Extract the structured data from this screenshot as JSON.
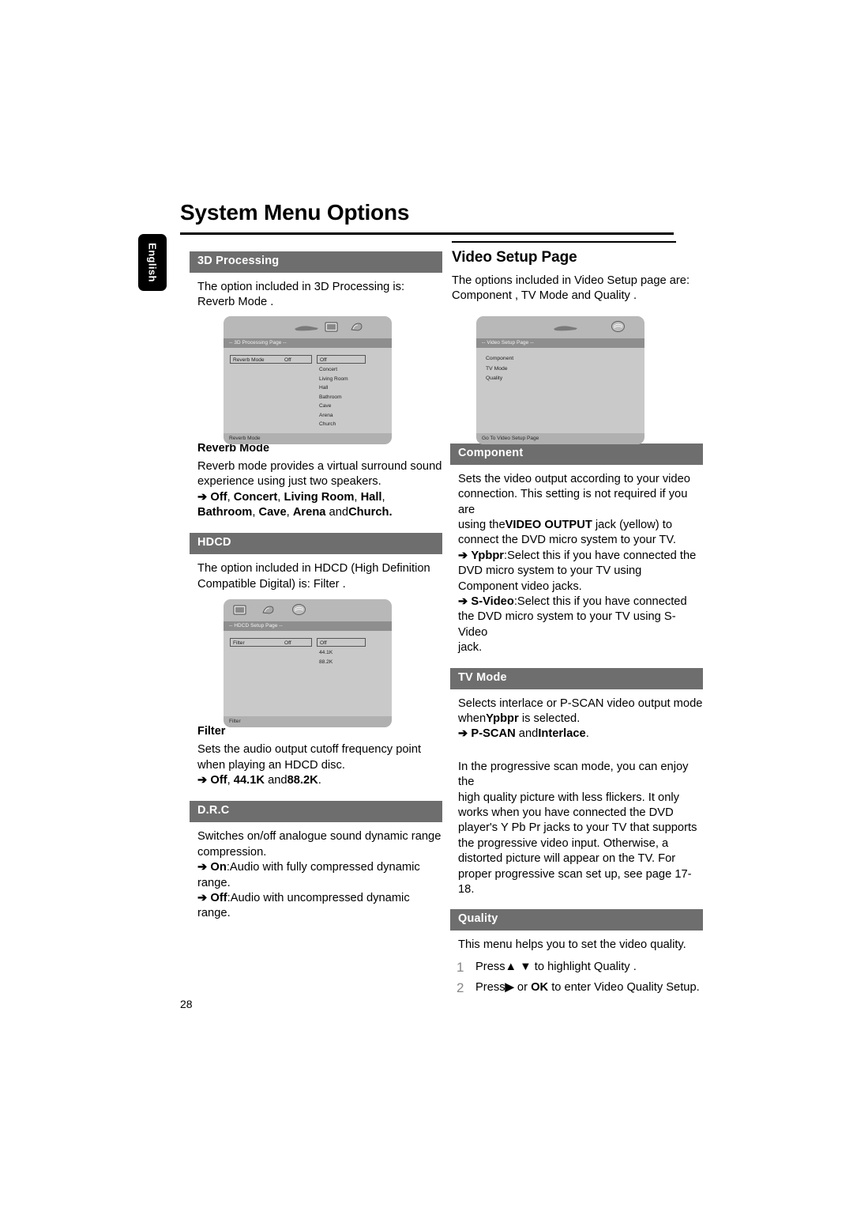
{
  "page": {
    "title": "System Menu Options",
    "language_tab": "English",
    "page_number": "28"
  },
  "left_column": {
    "processing": {
      "bar_label": "3D Processing",
      "intro_line1": "The option included in 3D Processing is:",
      "intro_line2": "Reverb Mode ."
    },
    "osd_3d": {
      "title": "-- 3D Processing Page --",
      "row_label": "Reverb Mode",
      "row_value": "Off",
      "selected_option": "Off",
      "options": [
        "Concert",
        "Living Room",
        "Hall",
        "Bathroom",
        "Cave",
        "Arena",
        "Church"
      ],
      "status": "Reverb Mode",
      "icons": [
        "video-icon",
        "audio-icon"
      ]
    },
    "reverb": {
      "head": "Reverb Mode",
      "body_line1": "Reverb mode provides a virtual surround sound",
      "body_line2": "experience using just two speakers.",
      "bullet_prefix": "➔",
      "bullet_line1_bold1": "Off",
      "bullet_line1_sep1": ", ",
      "bullet_line1_bold2": "Concert",
      "bullet_line1_sep2": ", ",
      "bullet_line1_bold3": "Living Room",
      "bullet_line1_sep3": ", ",
      "bullet_line1_bold4": "Hall",
      "bullet_line1_end": ",",
      "bullet_line2_bold1": "Bathroom",
      "bullet_line2_sep1": ", ",
      "bullet_line2_bold2": "Cave",
      "bullet_line2_sep2": ", ",
      "bullet_line2_bold3": "Arena",
      "bullet_line2_and": " and",
      "bullet_line2_bold4": "Church."
    },
    "hdcd": {
      "bar_label": "HDCD",
      "body_line1": "The option included in HDCD (High Definition",
      "body_line2": "Compatible Digital) is:  Filter ."
    },
    "osd_hdcd": {
      "title": "-- HDCD Setup Page --",
      "row_label": "Filter",
      "row_value": "Off",
      "selected_option": "Off",
      "options": [
        "44.1K",
        "88.2K"
      ],
      "status": "Filter",
      "icons": [
        "video-icon",
        "audio-icon",
        "preference-icon"
      ]
    },
    "filter": {
      "head": "Filter",
      "body_line1": "Sets the audio output cutoff frequency point",
      "body_line2": "when playing an HDCD disc.",
      "bullet_prefix": "➔",
      "bullet_bold1": "Off",
      "bullet_sep1": ", ",
      "bullet_bold2": "44.1K",
      "bullet_and": " and",
      "bullet_bold3": "88.2K",
      "bullet_end": "."
    },
    "drc": {
      "bar_label": "D.R.C",
      "body_line1": "Switches on/off analogue sound dynamic range",
      "body_line2": "compression.",
      "bullet1_prefix": "➔",
      "bullet1_bold": "On",
      "bullet1_text": ":Audio with fully compressed dynamic",
      "bullet1_cont": "range.",
      "bullet2_prefix": "➔",
      "bullet2_bold": "Off",
      "bullet2_text": ":Audio with uncompressed dynamic",
      "bullet2_cont": "range."
    }
  },
  "right_column": {
    "video_setup": {
      "head": "Video Setup Page",
      "intro_line1": "The options included in Video Setup page are:",
      "intro_line2": "Component , TV Mode  and  Quality ."
    },
    "osd_video": {
      "title": "-- Video Setup Page --",
      "menu_items": [
        "Component",
        "TV Mode",
        "Quality"
      ],
      "status": "Go To Video Setup Page",
      "icons": [
        "preference-icon"
      ]
    },
    "component": {
      "bar_label": "Component",
      "body_line1": "Sets the video output according to your video",
      "body_line2_a": "connection. This setting is not required if you are",
      "body_line3_pre": "using the",
      "body_line3_bold": "VIDEO OUTPUT",
      "body_line3_post": " jack (yellow) to",
      "body_line4": "connect the DVD micro system to your TV.",
      "bullet1_prefix": "➔",
      "bullet1_bold": "Ypbpr",
      "bullet1_text": ":Select this if you have connected the",
      "bullet1_cont1": "DVD micro system to your TV using",
      "bullet1_cont2": "Component video jacks.",
      "bullet2_prefix": "➔",
      "bullet2_bold": "S-Video",
      "bullet2_text": ":Select this if you have connected",
      "bullet2_cont1": "the DVD micro system to your TV using S-Video",
      "bullet2_cont2": "jack."
    },
    "tv_mode": {
      "bar_label": "TV Mode",
      "body_line1": "Selects interlace or P-SCAN video output mode",
      "body_line2_pre": "when",
      "body_line2_bold": "Ypbpr",
      "body_line2_post": " is selected.",
      "bullet_prefix": "➔",
      "bullet_bold1": "P-SCAN",
      "bullet_and": " and",
      "bullet_bold2": "Interlace",
      "bullet_end": ".",
      "para2_line1": "In the progressive scan mode, you can enjoy the",
      "para2_line2": "high quality picture with less flickers. It only",
      "para2_line3": "works when you have connected the DVD",
      "para2_line4": "player's Y Pb Pr jacks to your TV that supports",
      "para2_line5": "the progressive video input. Otherwise, a",
      "para2_line6": "distorted picture will appear on the TV. For",
      "para2_line7": "proper progressive scan set up, see page 17-18."
    },
    "quality": {
      "bar_label": "Quality",
      "body_line1": "This menu helps you to set the video quality.",
      "step1_num": "1",
      "step1_pre": "Press",
      "step1_icons": "▲ ▼",
      "step1_post": " to highlight Quality .",
      "step2_num": "2",
      "step2_pre": "Press",
      "step2_icon": "▶",
      "step2_mid": " or ",
      "step2_bold": "OK",
      "step2_post": " to enter Video Quality Setup."
    }
  },
  "colors": {
    "section_bar": "#6e6e6e",
    "osd_body": "#c9c9c9",
    "osd_title": "#8e8e8e",
    "osd_status": "#b0b0b0"
  }
}
